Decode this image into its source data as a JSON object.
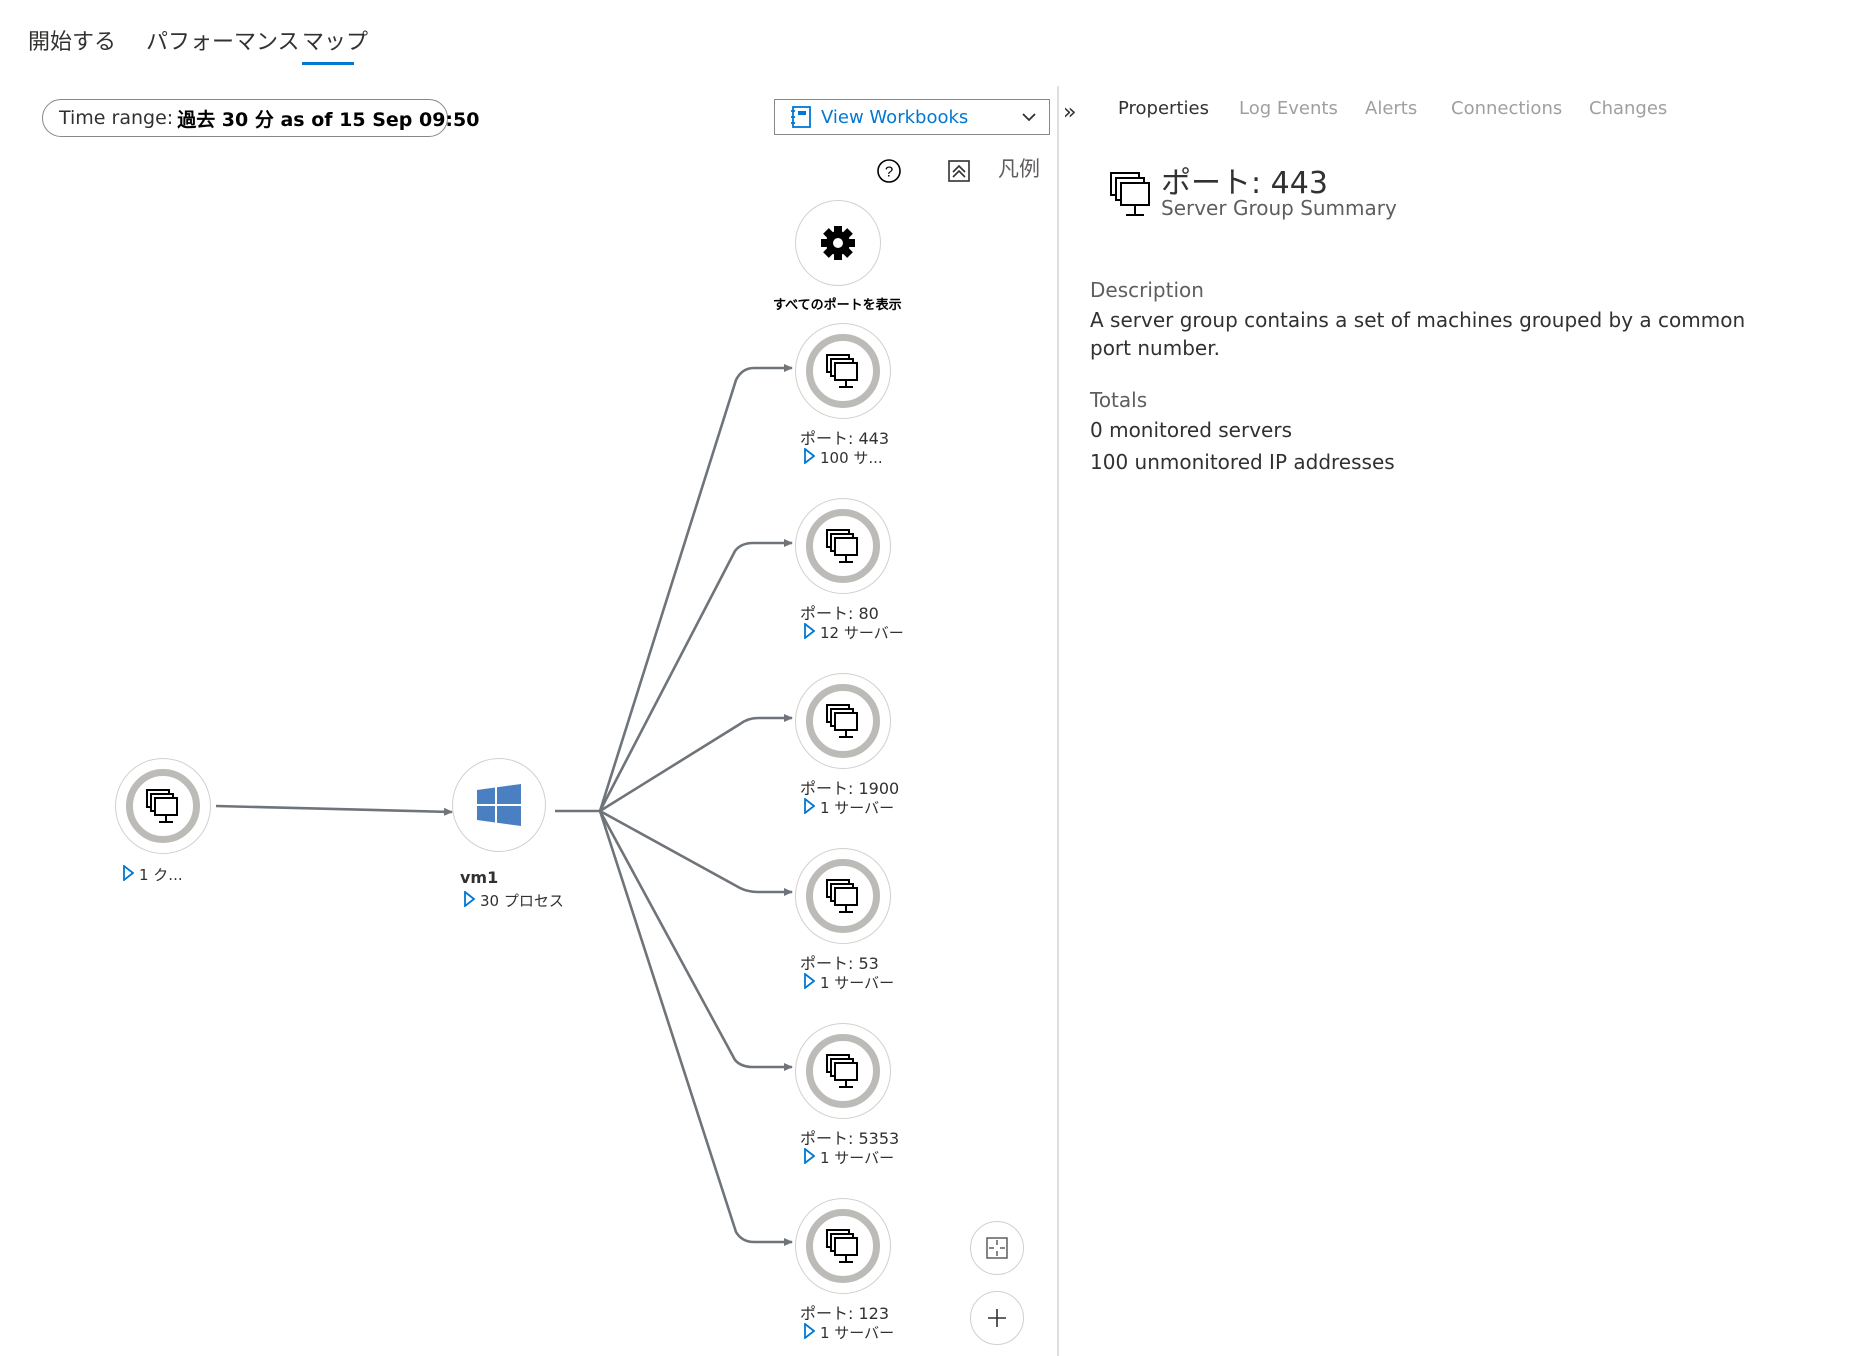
{
  "tabs": [
    {
      "label": "開始する",
      "active": false
    },
    {
      "label": "パフォーマンス",
      "active": false
    },
    {
      "label": "マップ",
      "active": true
    }
  ],
  "time_range": {
    "label": "Time range:",
    "value": "過去 30 分 as of 15 Sep 09:50"
  },
  "workbooks": {
    "label": "View Workbooks",
    "icon": "workbook-icon"
  },
  "toolbar": {
    "help_icon": "help-icon",
    "collapse_icon": "collapse-up-icon",
    "legend_label": "凡例"
  },
  "gear": {
    "label": "すべてのポートを表示",
    "icon": "gear-icon"
  },
  "client_node": {
    "sub": "1 ク..."
  },
  "vm_node": {
    "title": "vm1",
    "sub": "30 プロセス",
    "icon": "windows-icon"
  },
  "port_nodes": [
    {
      "title": "ポート: 443",
      "sub": "100 サ..."
    },
    {
      "title": "ポート: 80",
      "sub": "12 サーバー"
    },
    {
      "title": "ポート: 1900",
      "sub": "1 サーバー"
    },
    {
      "title": "ポート: 53",
      "sub": "1 サーバー"
    },
    {
      "title": "ポート: 5353",
      "sub": "1 サーバー"
    },
    {
      "title": "ポート: 123",
      "sub": "1 サーバー"
    }
  ],
  "zoom": {
    "fit_icon": "fit-to-screen-icon",
    "zoom_in_icon": "plus-icon"
  },
  "panel": {
    "collapse_label": "»",
    "tabs": [
      {
        "label": "Properties",
        "active": true
      },
      {
        "label": "Log Events",
        "active": false
      },
      {
        "label": "Alerts",
        "active": false
      },
      {
        "label": "Connections",
        "active": false
      },
      {
        "label": "Changes",
        "active": false
      }
    ],
    "title": "ポート: 443",
    "subtitle": "Server Group Summary",
    "description_heading": "Description",
    "description_text": "A server group contains a set of machines grouped by a common port number.",
    "totals_heading": "Totals",
    "monitored": "0 monitored servers",
    "unmonitored": "100 unmonitored IP addresses"
  },
  "colors": {
    "accent": "#0078d4",
    "edge": "#6e7479",
    "ring": "#bdbbb8"
  }
}
